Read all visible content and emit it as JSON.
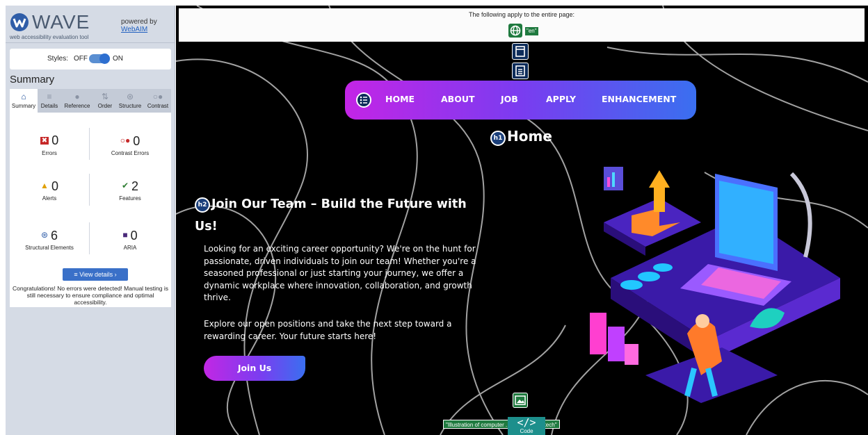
{
  "wave": {
    "logo": "WAVE",
    "tagline": "web accessibility evaluation tool",
    "powered_by": "powered by",
    "powered_link": "WebAIM",
    "styles_label": "Styles:",
    "styles_off": "OFF",
    "styles_on": "ON",
    "summary_title": "Summary",
    "tabs": [
      "Summary",
      "Details",
      "Reference",
      "Order",
      "Structure",
      "Contrast"
    ],
    "stats": {
      "errors": {
        "value": "0",
        "label": "Errors"
      },
      "contrast_errors": {
        "value": "0",
        "label": "Contrast Errors"
      },
      "alerts": {
        "value": "0",
        "label": "Alerts"
      },
      "features": {
        "value": "2",
        "label": "Features"
      },
      "structural": {
        "value": "6",
        "label": "Structural Elements"
      },
      "aria": {
        "value": "0",
        "label": "ARIA"
      }
    },
    "view_details": "View details ›",
    "congrats": "Congratulations! No errors were detected! Manual testing is still necessary to ensure compliance and optimal accessibility.",
    "colors": {
      "sidebar_bg": "#d5dbe5",
      "accent": "#3a70c8",
      "error": "#c62828",
      "alert": "#e0a000",
      "feature": "#2e7d32",
      "aria": "#4a2a7a"
    }
  },
  "page": {
    "note": "The following apply to the entire page:",
    "lang_badge": "\"en\"",
    "nav": [
      "HOME",
      "ABOUT",
      "JOB",
      "APPLY",
      "ENHANCEMENT"
    ],
    "h1_badge": "h1",
    "h1": "Home",
    "h2_badge": "h2",
    "h2": "Join Our Team – Build the Future with Us!",
    "para1": "Looking for an exciting career opportunity? We're on the hunt for passionate, driven individuals to join our team! Whether you're a seasoned professional or just starting your journey, we offer a dynamic workplace where innovation, collaboration, and growth thrive.",
    "para2": "Explore our open positions and take the next step toward a rewarding career. Your future starts here!",
    "join_button": "Join Us",
    "alt_badge": "\"Illustration of computer ... g a career in tech\"",
    "code_tab": "Code",
    "colors": {
      "nav_start": "#c325e6",
      "nav_end": "#3a6ff0",
      "bg": "#000000"
    }
  }
}
